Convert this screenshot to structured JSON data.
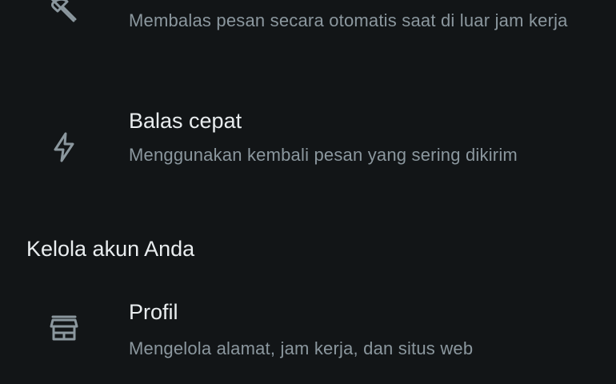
{
  "away_message": {
    "icon": "beach-umbrella-off-icon",
    "description": "Membalas pesan secara otomatis saat di luar jam kerja"
  },
  "quick_replies": {
    "icon": "lightning-bolt-icon",
    "title": "Balas cepat",
    "description": "Menggunakan kembali pesan yang sering dikirim"
  },
  "manage_account": {
    "section_title": "Kelola akun Anda"
  },
  "profile": {
    "icon": "storefront-icon",
    "title": "Profil",
    "description": "Mengelola alamat, jam kerja, dan situs web"
  },
  "colors": {
    "background": "#121517",
    "title_text": "#e9edef",
    "secondary_text": "#8b979e",
    "icon": "#8b979e"
  }
}
